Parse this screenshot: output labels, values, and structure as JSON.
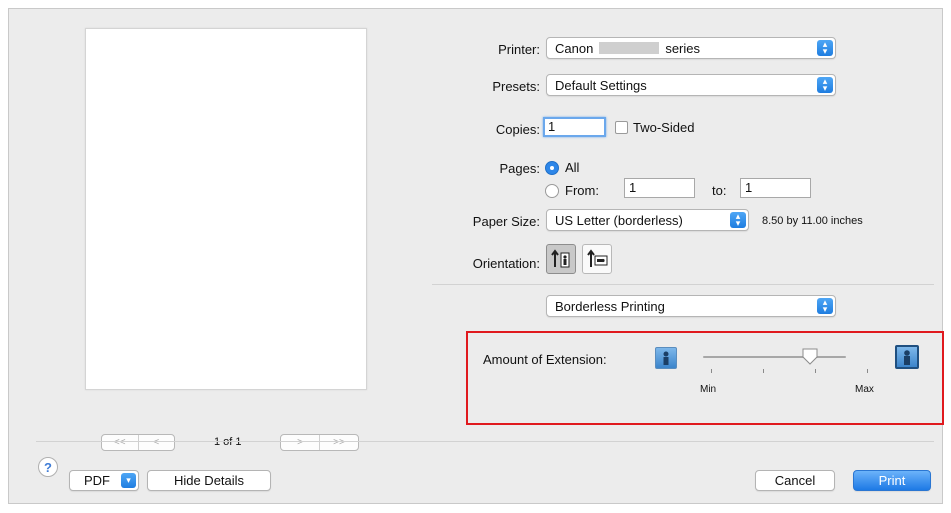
{
  "preview": {
    "nav_first": "<<",
    "nav_prev": "<",
    "nav_next": ">",
    "nav_last": ">>",
    "page_count": "1 of 1"
  },
  "printer": {
    "label": "Printer:",
    "value_prefix": "Canon",
    "value_suffix": "series"
  },
  "presets": {
    "label": "Presets:",
    "value": "Default Settings"
  },
  "copies": {
    "label": "Copies:",
    "value": "1",
    "two_sided_label": "Two-Sided",
    "two_sided_checked": false
  },
  "pages": {
    "label": "Pages:",
    "all_label": "All",
    "from_label": "From:",
    "from_value": "1",
    "to_label": "to:",
    "to_value": "1",
    "selected": "All"
  },
  "paper_size": {
    "label": "Paper Size:",
    "value": "US Letter (borderless)",
    "dimensions": "8.50 by 11.00 inches"
  },
  "orientation": {
    "label": "Orientation:",
    "selected": "portrait"
  },
  "section_popup": {
    "value": "Borderless Printing"
  },
  "extension": {
    "label": "Amount of Extension:",
    "min_label": "Min",
    "max_label": "Max",
    "level": 0.75
  },
  "footer": {
    "help_label": "?",
    "pdf_label": "PDF",
    "hide_details_label": "Hide Details",
    "cancel_label": "Cancel",
    "print_label": "Print"
  },
  "colors": {
    "accent": "#2d86e8",
    "highlight_box": "#e0191e"
  }
}
